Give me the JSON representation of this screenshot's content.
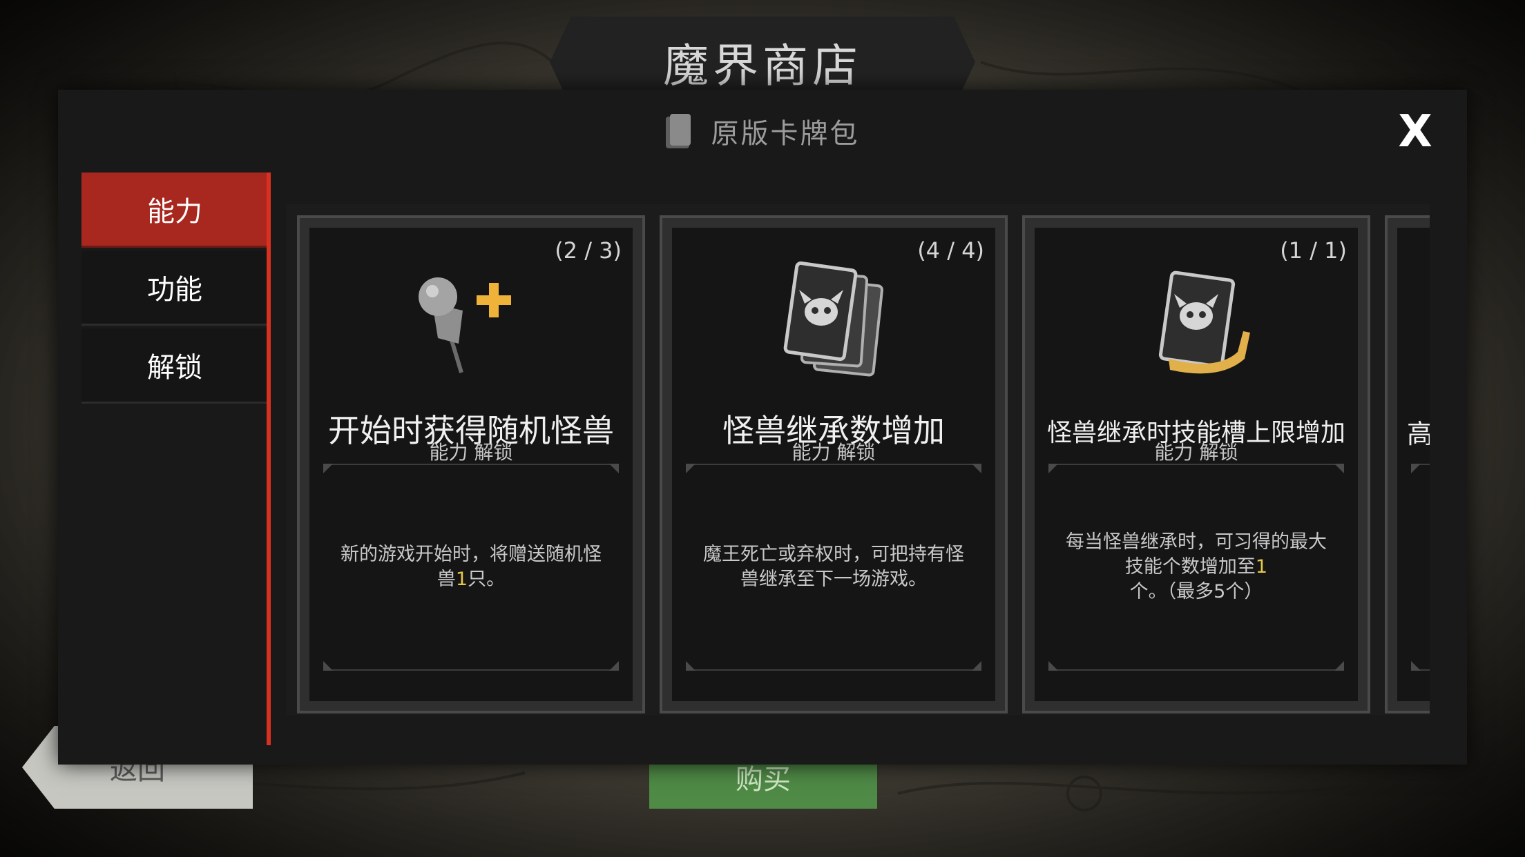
{
  "window": {
    "title": "魔界商店"
  },
  "panel": {
    "subtitle": "原版卡牌包",
    "close_label": "X"
  },
  "sidebar": {
    "items": [
      {
        "label": "能力",
        "active": true
      },
      {
        "label": "功能",
        "active": false
      },
      {
        "label": "解锁",
        "active": false
      }
    ]
  },
  "cards": [
    {
      "count": "(2 / 3)",
      "title": "开始时获得随机怪兽",
      "subtitle": "能力 解锁",
      "desc_pre": "新的游戏开始时，将赠送随机怪兽",
      "desc_hl": "1",
      "desc_post": "只。",
      "icon": "pin-plus-icon"
    },
    {
      "count": "(4 / 4)",
      "title": "怪兽继承数增加",
      "subtitle": "能力 解锁",
      "desc_pre": "魔王死亡或弃权时，可把持有怪兽继承至下一场游戏。",
      "desc_hl": "",
      "desc_post": "",
      "icon": "demon-cards-icon"
    },
    {
      "count": "(1 / 1)",
      "title": "怪兽继承时技能槽上限增加",
      "subtitle": "能力 解锁",
      "desc_pre": "每当怪兽继承时，可习得的最大技能个数增加至",
      "desc_hl": "1",
      "desc_post": "个。（最多5个）",
      "icon": "demon-card-arrow-icon"
    }
  ],
  "partial_card": {
    "title_char": "高"
  },
  "background_buttons": {
    "back": "返回",
    "buy": "购买"
  },
  "colors": {
    "active_tab": "#a8281f",
    "divider": "#d8311f",
    "highlight": "#e6c84a",
    "buy_button": "#4f8a46"
  }
}
